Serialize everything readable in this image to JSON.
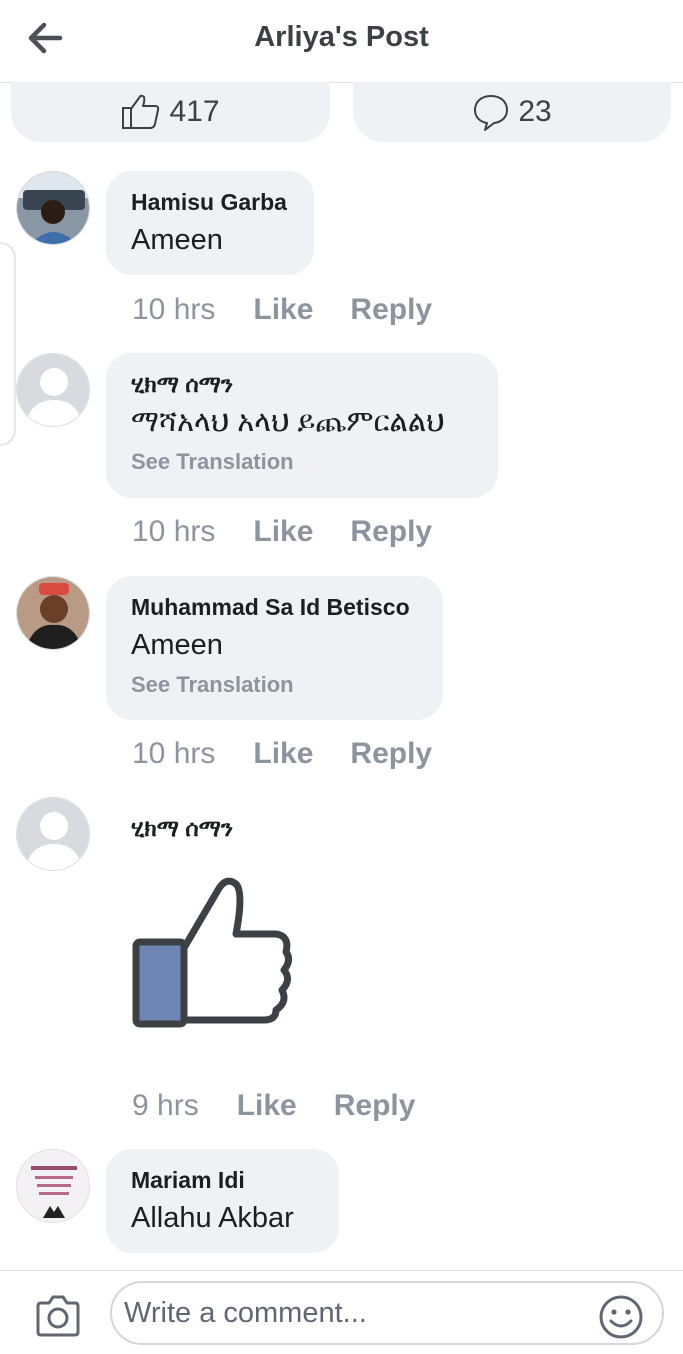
{
  "header": {
    "title": "Arliya's Post",
    "back_icon": "arrow-left-icon"
  },
  "stats": {
    "likes": "417",
    "comments": "23",
    "like_icon": "thumbs-up-outline-icon",
    "comment_icon": "speech-bubble-icon"
  },
  "comments": [
    {
      "name": "Hamisu Garba",
      "text": "Ameen",
      "time": "10 hrs",
      "like": "Like",
      "reply": "Reply"
    },
    {
      "name": "ሂክማ ሰማን",
      "text": "ማሻአላህ አላህ ይጨምርልልህ",
      "see_translation": "See Translation",
      "time": "10 hrs",
      "like": "Like",
      "reply": "Reply"
    },
    {
      "name": "Muhammad Sa Id Betisco",
      "text": "Ameen",
      "see_translation": "See Translation",
      "time": "10 hrs",
      "like": "Like",
      "reply": "Reply"
    },
    {
      "name": "ሂክማ ሰማን",
      "sticker": "thumbs-up-sticker",
      "time": "9 hrs",
      "like": "Like",
      "reply": "Reply"
    },
    {
      "name": "Mariam Idi",
      "text": "Allahu Akbar"
    }
  ],
  "composer": {
    "placeholder": "Write a comment...",
    "camera_icon": "camera-icon",
    "emoji_icon": "smiley-icon"
  },
  "colors": {
    "bubble": "#f0f1f4",
    "meta_text": "#8d949e",
    "title_text": "#3d4045",
    "sticker_blue": "#6d86b5"
  }
}
